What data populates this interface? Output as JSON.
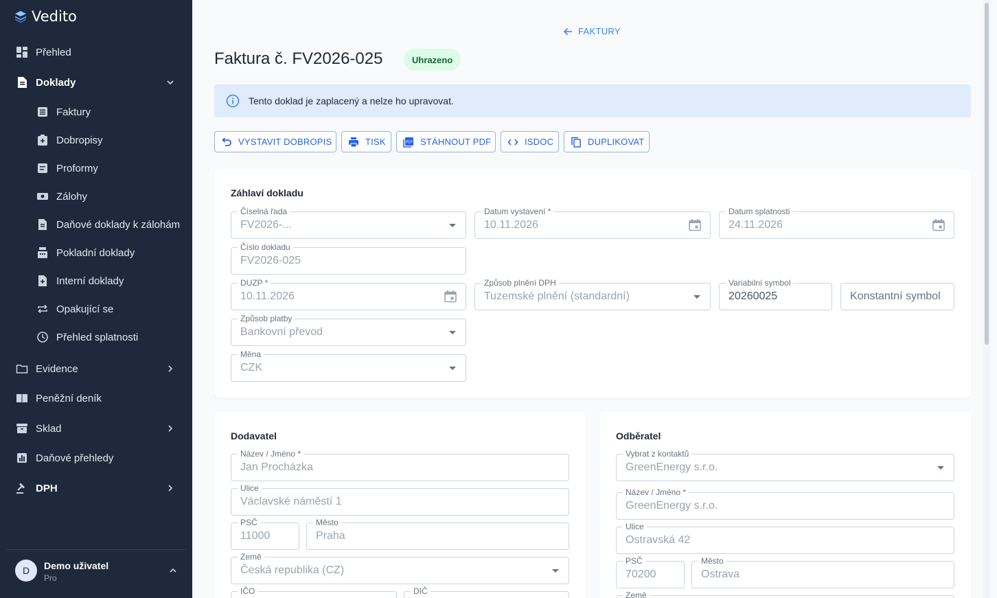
{
  "app": {
    "name": "Vedito"
  },
  "sidebar": {
    "items": [
      {
        "label": "Přehled",
        "icon": "dashboard-icon"
      },
      {
        "label": "Doklady",
        "icon": "document-icon",
        "expanded": true
      },
      {
        "label": "Evidence",
        "icon": "folder-icon"
      },
      {
        "label": "Peněžní deník",
        "icon": "book-icon"
      },
      {
        "label": "Sklad",
        "icon": "archive-icon"
      },
      {
        "label": "Daňové přehledy",
        "icon": "chart-icon"
      },
      {
        "label": "DPH",
        "icon": "gavel-icon"
      }
    ],
    "sub_items": [
      {
        "label": "Faktury",
        "icon": "invoice-icon"
      },
      {
        "label": "Dobropisy",
        "icon": "credit-note-icon"
      },
      {
        "label": "Proformy",
        "icon": "proforma-icon"
      },
      {
        "label": "Zálohy",
        "icon": "advance-icon"
      },
      {
        "label": "Daňové doklady k zálohám",
        "icon": "tax-document-icon"
      },
      {
        "label": "Pokladní doklady",
        "icon": "cash-register-icon"
      },
      {
        "label": "Interní doklady",
        "icon": "internal-document-icon"
      },
      {
        "label": "Opakující se",
        "icon": "repeat-icon"
      },
      {
        "label": "Přehled splatnosti",
        "icon": "clock-icon"
      }
    ],
    "user": {
      "initial": "D",
      "name": "Demo uživatel",
      "plan": "Pro"
    }
  },
  "header": {
    "back_label": "FAKTURY",
    "title": "Faktura č. FV2026-025",
    "status": "Uhrazeno",
    "status_color": "#dcfce7"
  },
  "alert": {
    "text": "Tento doklad je zaplacený a nelze ho upravovat."
  },
  "actions": [
    {
      "label": "VYSTAVIT DOBROPIS",
      "icon": "undo-icon"
    },
    {
      "label": "TISK",
      "icon": "print-icon"
    },
    {
      "label": "STÁHNOUT PDF",
      "icon": "pdf-icon"
    },
    {
      "label": "ISDOC",
      "icon": "code-icon"
    },
    {
      "label": "DUPLIKOVAT",
      "icon": "copy-icon"
    }
  ],
  "header_section": {
    "title": "Záhlaví dokladu",
    "fields": {
      "series": {
        "label": "Číselná řada",
        "value": "FV2026-..."
      },
      "issue_date": {
        "label": "Datum vystavení *",
        "value": "10.11.2026"
      },
      "due_date": {
        "label": "Datum splatnosti",
        "value": "24.11.2026"
      },
      "doc_number": {
        "label": "Číslo dokladu",
        "value": "FV2026-025"
      },
      "duzp": {
        "label": "DUZP *",
        "value": "10.11.2026"
      },
      "vat_mode": {
        "label": "Způsob plnění DPH",
        "value": "Tuzemské plnění (standardní)"
      },
      "var_symbol": {
        "label": "Variabilní symbol",
        "value": "20260025"
      },
      "const_symbol": {
        "placeholder": "Konstantní symbol"
      },
      "payment": {
        "label": "Způsob platby",
        "value": "Bankovní převod"
      },
      "currency": {
        "label": "Měna",
        "value": "CZK"
      }
    }
  },
  "supplier": {
    "title": "Dodavatel",
    "name": {
      "label": "Název / Jméno *",
      "value": "Jan Procházka"
    },
    "street": {
      "label": "Ulice",
      "value": "Václavské náměstí 1"
    },
    "zip": {
      "label": "PSČ",
      "value": "11000"
    },
    "city": {
      "label": "Město",
      "value": "Praha"
    },
    "country": {
      "label": "Země",
      "value": "Česká republika (CZ)"
    },
    "ico": {
      "label": "IČO"
    },
    "dic": {
      "label": "DIČ"
    }
  },
  "customer": {
    "title": "Odběratel",
    "contact": {
      "label": "Vybrat z kontaktů",
      "value": "GreenEnergy s.r.o."
    },
    "name": {
      "label": "Název / Jméno *",
      "value": "GreenEnergy s.r.o."
    },
    "street": {
      "label": "Ulice",
      "value": "Ostravská 42"
    },
    "zip": {
      "label": "PSČ",
      "value": "70200"
    },
    "city": {
      "label": "Město",
      "value": "Ostrava"
    },
    "country": {
      "label": "Země"
    }
  }
}
